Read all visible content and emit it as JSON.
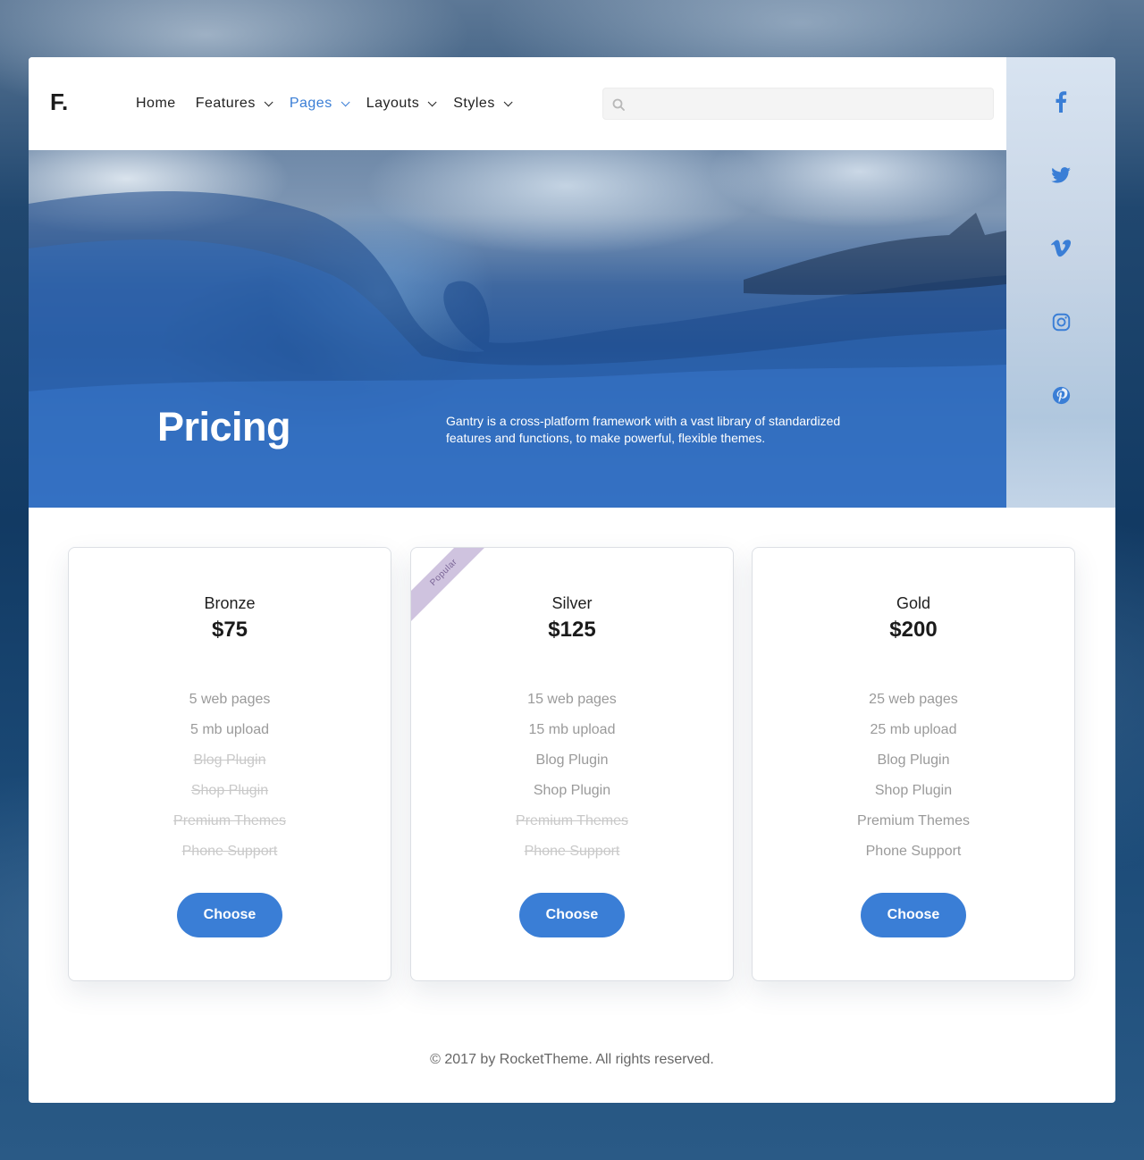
{
  "header": {
    "logo": "F.",
    "nav": [
      {
        "label": "Home",
        "dropdown": false,
        "active": false
      },
      {
        "label": "Features",
        "dropdown": true,
        "active": false
      },
      {
        "label": "Pages",
        "dropdown": true,
        "active": true
      },
      {
        "label": "Layouts",
        "dropdown": true,
        "active": false
      },
      {
        "label": "Styles",
        "dropdown": true,
        "active": false
      }
    ],
    "search": {
      "placeholder": "",
      "value": "",
      "icon": "search-icon"
    }
  },
  "social": {
    "icons": [
      "facebook-icon",
      "twitter-icon",
      "vimeo-icon",
      "instagram-icon",
      "pinterest-icon"
    ],
    "color": "#3a7ed6"
  },
  "hero": {
    "title": "Pricing",
    "text": "Gantry is a cross-platform framework with a vast library of standardized features and functions, to make powerful, flexible themes."
  },
  "plans": [
    {
      "name": "Bronze",
      "price": "$75",
      "badge": "",
      "features": [
        {
          "label": "5 web pages",
          "included": true
        },
        {
          "label": "5 mb upload",
          "included": true
        },
        {
          "label": "Blog Plugin",
          "included": false
        },
        {
          "label": "Shop Plugin",
          "included": false
        },
        {
          "label": "Premium Themes",
          "included": false
        },
        {
          "label": "Phone Support",
          "included": false
        }
      ],
      "button": "Choose"
    },
    {
      "name": "Silver",
      "price": "$125",
      "badge": "Popular",
      "features": [
        {
          "label": "15 web pages",
          "included": true
        },
        {
          "label": "15 mb upload",
          "included": true
        },
        {
          "label": "Blog Plugin",
          "included": true
        },
        {
          "label": "Shop Plugin",
          "included": true
        },
        {
          "label": "Premium Themes",
          "included": false
        },
        {
          "label": "Phone Support",
          "included": false
        }
      ],
      "button": "Choose"
    },
    {
      "name": "Gold",
      "price": "$200",
      "badge": "",
      "features": [
        {
          "label": "25 web pages",
          "included": true
        },
        {
          "label": "25 mb upload",
          "included": true
        },
        {
          "label": "Blog Plugin",
          "included": true
        },
        {
          "label": "Shop Plugin",
          "included": true
        },
        {
          "label": "Premium Themes",
          "included": true
        },
        {
          "label": "Phone Support",
          "included": true
        }
      ],
      "button": "Choose"
    }
  ],
  "footer": {
    "copyright": "© 2017 by RocketTheme. All rights reserved."
  },
  "colors": {
    "accent": "#3a7ed6",
    "badge_bg": "#cfc3df",
    "badge_text": "#7a6596"
  }
}
